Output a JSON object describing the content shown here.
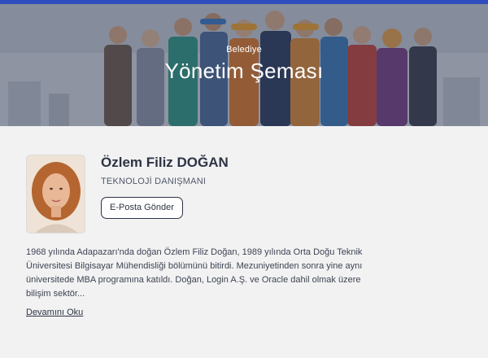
{
  "colors": {
    "accent_bar": "#2f4dbd",
    "page_background": "#f2f2f3",
    "name_text": "#2d3444"
  },
  "hero": {
    "kicker": "Belediye",
    "title": "Yönetim Şeması",
    "image": "people-group-illustration"
  },
  "profile": {
    "photo": "portrait-photo",
    "name": "Özlem Filiz DOĞAN",
    "role": "TEKNOLOJİ DANIŞMANI",
    "email_button_label": "E-Posta Gönder"
  },
  "bio": {
    "text": "1968 yılında Adapazarı'nda doğan Özlem Filiz Doğan, 1989 yılında Orta Doğu Teknik Üniversitesi Bilgisayar Mühendisliği bölümünü bitirdi. Mezuniyetinden sonra yine aynı üniversitede MBA programına katıldı. Doğan, Login A.Ş. ve Oracle dahil olmak üzere bilişim sektör...",
    "read_more_label": "Devamını Oku"
  }
}
